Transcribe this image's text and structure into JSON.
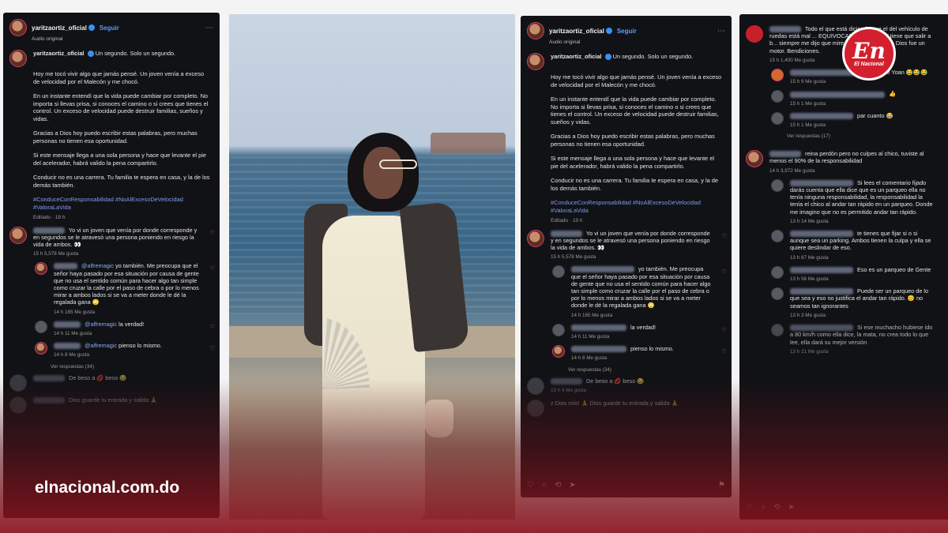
{
  "left_panel": {
    "username": "yaritzaortiz_oficial",
    "follow_label": "Seguir",
    "audio_label": "Audio original",
    "caption_first": "Un segundo. Solo un segundo.",
    "caption_paragraphs": [
      "Hoy me tocó vivir algo que jamás pensé. Un joven venía a exceso de velocidad por el Malecón y me chocó.",
      "En un instante entendí que la vida puede cambiar por completo. No importa si llevas prisa, si conoces el camino o si crees que tienes el control. Un exceso de velocidad puede destruir familias, sueños y vidas.",
      "Gracias a Dios hoy puedo escribir estas palabras, pero muchas personas no tienen esa oportunidad.",
      "Si este mensaje llega a una sola persona y hace que levante el pie del acelerador, habrá valido la pena compartirlo.",
      "Conducir no es una carrera. Tu familia te espera en casa, y la de los demás también."
    ],
    "hashtags": "#ConduceConResponsabilidad #NoAlExcesoDeVelocidad #ValoraLaVida",
    "edited": "Editado · 19 h",
    "comments": [
      {
        "text": "Yo vi un joven que venía por donde corresponde y en segundos se le atravesó una persona poniendo en riesgo la vida de ambos. 👀",
        "meta": "15 h   5,578 Me gusta"
      },
      {
        "mention": "@alfremagic",
        "text": "yo también. Me preocupa que el señor haya pasado por esa situación por causa de gente que no usa el sentido común para hacer algo tan simple como cruzar la calle por el paso de cebra o por lo menos mirar a ambos lados si se va a meter donde le dé la regalada gana 🙄",
        "meta": "14 h   165 Me gusta"
      },
      {
        "mention": "@alfremagic",
        "text": "la verdad!",
        "meta": "14 h   11 Me gusta"
      },
      {
        "mention": "@alfremagic",
        "text": "pienso lo mismo.",
        "meta": "14 h   8 Me gusta"
      }
    ],
    "view_replies": "Ver respuestas (34)",
    "faded_comments": [
      "De beso a 💋 beso 😂",
      "Dios guarde tu entrada y salida 🙏"
    ]
  },
  "middle_panel": {
    "username": "yaritzaortiz_oficial",
    "follow_label": "Seguir",
    "audio_label": "Audio original",
    "caption_first": "Un segundo. Solo un segundo.",
    "hashtags": "#ConduceConResponsabilidad #NoAlExcesoDeVelocidad #ValoraLaVida",
    "edited": "Editado · 19 h",
    "comments": [
      {
        "text": "Yo vi un joven que venía por donde corresponde y en segundos se le atravesó una persona poniendo en riesgo la vida de ambos. 👀",
        "meta": "15 h   5,578 Me gusta"
      },
      {
        "text": "yo también. Me preocupa que el señor haya pasado por esa situación por causa de gente que no usa el sentido común para hacer algo tan simple como cruzar la calle por el paso de cebra o por lo menos mirar a ambos lados si se va a meter donde le dé la regalada gana 🙄",
        "meta": "14 h   165 Me gusta"
      },
      {
        "text": "la verdad!",
        "meta": "14 h   11 Me gusta"
      },
      {
        "text": "pienso lo mismo.",
        "meta": "14 h   8 Me gusta"
      }
    ],
    "view_replies": "Ver respuestas (34)",
    "faded_comments": [
      {
        "text": "De beso a 💋 beso 😂",
        "meta": "19 h   4 Me gusta"
      },
      {
        "text": "z Dios mío! 🙏 Dios guarde tu entrada y salida 🙏",
        "meta": ""
      }
    ]
  },
  "right_panel": {
    "top_comment": "Todo el que está diciendo que el del vehículo de ruedas está mal ... EQUIVOCADO o los AMET tiene que salir a b... siempre me dijo que mire a ambos lados ... a Dios fue un motor. Bendiciones.",
    "top_meta": "15 h   1,400 Me gusta",
    "comments": [
      {
        "text": "voz de Yoan 😂😂😂",
        "meta": "15 h   9 Me gusta"
      },
      {
        "text": "👍",
        "meta": "15 h   1 Me gusta"
      },
      {
        "text": "par cuanto 😂",
        "meta": "15 h   1 Me gusta"
      }
    ],
    "view_replies": "Ver respuestas (17)",
    "main_comment": "reina perdón pero no culpes al chico, tuviste al menos el 90% de la responsabilidad",
    "main_meta": "14 h   3,972 Me gusta",
    "replies": [
      {
        "text": "Si lees el comentario fijado darás cuenta que ella dice que es un parqueo ella no tenía ninguna responsabilidad, la responsabilidad la tenía el chico al andar tan rápido en un parqueo. Donde me imagino que no es permitido andar tan rápido.",
        "meta": "13 h   14 Me gusta"
      },
      {
        "text": "te tienes que fijar si o si aunque sea un parking. Ambos tienen la culpa y ella se quiere deslindar de eso.",
        "meta": "13 h   87 Me gusta"
      },
      {
        "text": "Eso es un parqueo de Gente",
        "meta": "13 h   56 Me gusta"
      },
      {
        "text": "Puede ser un parqueo de lo que sea y eso no justifica el andar tan rápido. 😊 no seamos tan ignorantes",
        "meta": "13 h   3 Me gusta"
      },
      {
        "text": "Si ese muchacho hubiese ido a 80 km/h como ella dice, la mata, no crea todo lo que lee, ella dará su mejor versión",
        "meta": "13 h   21 Me gusta"
      }
    ]
  },
  "watermark": "elnacional.com.do",
  "brand_logo": {
    "short": "En",
    "name": "El Nacional"
  },
  "colors": {
    "brand_red": "#d3202e",
    "link_blue": "#5a9ef5",
    "panel_bg": "#111216"
  }
}
